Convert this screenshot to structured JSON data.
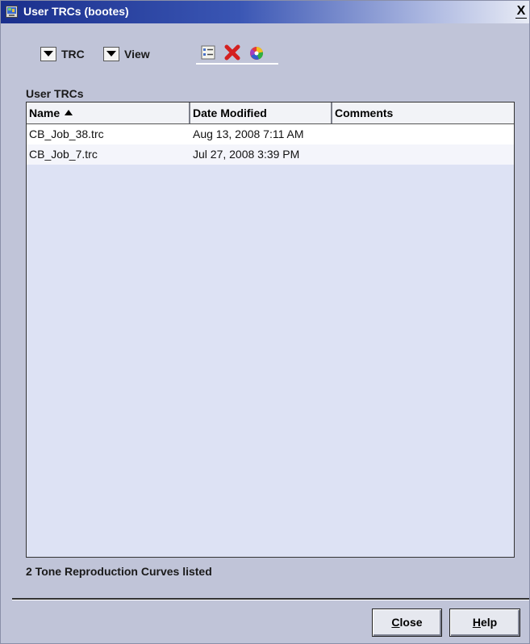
{
  "window": {
    "title": "User TRCs (bootes)",
    "close_glyph": "X"
  },
  "menus": [
    {
      "label": "TRC"
    },
    {
      "label": "View"
    }
  ],
  "toolbar": {
    "icons": [
      "properties-icon",
      "delete-icon",
      "color-wheel-icon"
    ]
  },
  "section_title": "User TRCs",
  "table": {
    "columns": [
      "Name",
      "Date Modified",
      "Comments"
    ],
    "sort_column": "Name",
    "sort_direction": "ascending",
    "rows": [
      {
        "name": "CB_Job_38.trc",
        "date": "Aug 13, 2008 7:11 AM",
        "comments": ""
      },
      {
        "name": "CB_Job_7.trc",
        "date": "Jul 27, 2008 3:39 PM",
        "comments": ""
      }
    ]
  },
  "status_text": "2 Tone Reproduction Curves listed",
  "buttons": {
    "close": {
      "mnemonic": "C",
      "rest": "lose"
    },
    "help": {
      "mnemonic": "H",
      "rest": "elp"
    }
  },
  "colors": {
    "titlebar_start": "#1a2f8c",
    "window_bg": "#c0c4d8",
    "table_bg": "#dde2f4",
    "delete_red": "#d42020"
  }
}
